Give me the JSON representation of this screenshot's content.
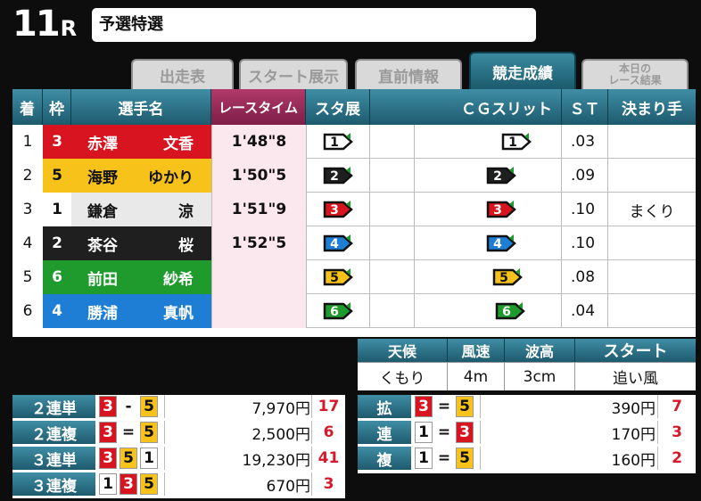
{
  "header": {
    "race_number": "11",
    "race_unit": "R",
    "race_name": "予選特選"
  },
  "tabs": [
    {
      "label": "出走表"
    },
    {
      "label": "スタート展示"
    },
    {
      "label": "直前情報"
    },
    {
      "label": "競走成績"
    },
    {
      "label_line1": "本日の",
      "label_line2": "レース結果"
    }
  ],
  "table": {
    "headers": {
      "rank": "着",
      "waku": "枠",
      "name": "選手名",
      "time": "レースタイム",
      "sta": "スタ展",
      "slit": "ＣＧスリット",
      "st": "ＳＴ",
      "kimari": "決まり手"
    },
    "rows": [
      {
        "rank": "1",
        "waku": "3",
        "family": "赤澤",
        "given": "文香",
        "time": "1'48\"8",
        "sta_course": "1",
        "slit_course": "1",
        "st": ".03",
        "kimari": ""
      },
      {
        "rank": "2",
        "waku": "5",
        "family": "海野",
        "given": "ゆかり",
        "time": "1'50\"5",
        "sta_course": "2",
        "slit_course": "2",
        "st": ".09",
        "kimari": ""
      },
      {
        "rank": "3",
        "waku": "1",
        "family": "鎌倉",
        "given": "涼",
        "time": "1'51\"9",
        "sta_course": "3",
        "slit_course": "3",
        "st": ".10",
        "kimari": "まくり"
      },
      {
        "rank": "4",
        "waku": "2",
        "family": "茶谷",
        "given": "桜",
        "time": "1'52\"5",
        "sta_course": "4",
        "slit_course": "4",
        "st": ".10",
        "kimari": ""
      },
      {
        "rank": "5",
        "waku": "6",
        "family": "前田",
        "given": "紗希",
        "time": "",
        "sta_course": "5",
        "slit_course": "5",
        "st": ".08",
        "kimari": ""
      },
      {
        "rank": "6",
        "waku": "4",
        "family": "勝浦",
        "given": "真帆",
        "time": "",
        "sta_course": "6",
        "slit_course": "6",
        "st": ".04",
        "kimari": ""
      }
    ]
  },
  "weather": {
    "headers": {
      "tenko": "天候",
      "fusoku": "風速",
      "hako": "波高",
      "start": "スタート"
    },
    "values": {
      "tenko": "くもり",
      "fusoku": "4m",
      "hako": "3cm",
      "start": "追い風"
    }
  },
  "payouts_left": [
    {
      "label": "２連単",
      "nums": [
        "3",
        "-",
        "5"
      ],
      "amount": "7,970円",
      "pop": "17"
    },
    {
      "label": "２連複",
      "nums": [
        "3",
        "=",
        "5"
      ],
      "amount": "2,500円",
      "pop": "6"
    },
    {
      "label": "３連単",
      "nums": [
        "3",
        "5",
        "1"
      ],
      "amount": "19,230円",
      "pop": "41"
    },
    {
      "label": "３連複",
      "nums": [
        "1",
        "3",
        "5"
      ],
      "amount": "670円",
      "pop": "3"
    }
  ],
  "payouts_right": [
    {
      "label": "拡",
      "nums": [
        "3",
        "=",
        "5"
      ],
      "amount": "390円",
      "pop": "7"
    },
    {
      "label": "連",
      "nums": [
        "1",
        "=",
        "3"
      ],
      "amount": "170円",
      "pop": "3"
    },
    {
      "label": "複",
      "nums": [
        "1",
        "=",
        "5"
      ],
      "amount": "160円",
      "pop": "2"
    }
  ],
  "waku_colors": {
    "1": {
      "bg": "#ffffff",
      "fg": "#111111",
      "row": "#e9e9e9"
    },
    "2": {
      "bg": "#1f1f1f",
      "fg": "#ffffff",
      "row": "#1f1f1f"
    },
    "3": {
      "bg": "#d7141f",
      "fg": "#ffffff",
      "row": "#d7141f"
    },
    "4": {
      "bg": "#1e7ed6",
      "fg": "#ffffff",
      "row": "#1e7ed6"
    },
    "5": {
      "bg": "#f7c31a",
      "fg": "#111111",
      "row": "#f7c31a"
    },
    "6": {
      "bg": "#1f9a2c",
      "fg": "#ffffff",
      "row": "#1f9a2c"
    }
  },
  "slit_offsets": {
    "1": 0.8,
    "2": 0.7,
    "3": 0.7,
    "4": 0.7,
    "5": 0.74,
    "6": 0.76
  }
}
